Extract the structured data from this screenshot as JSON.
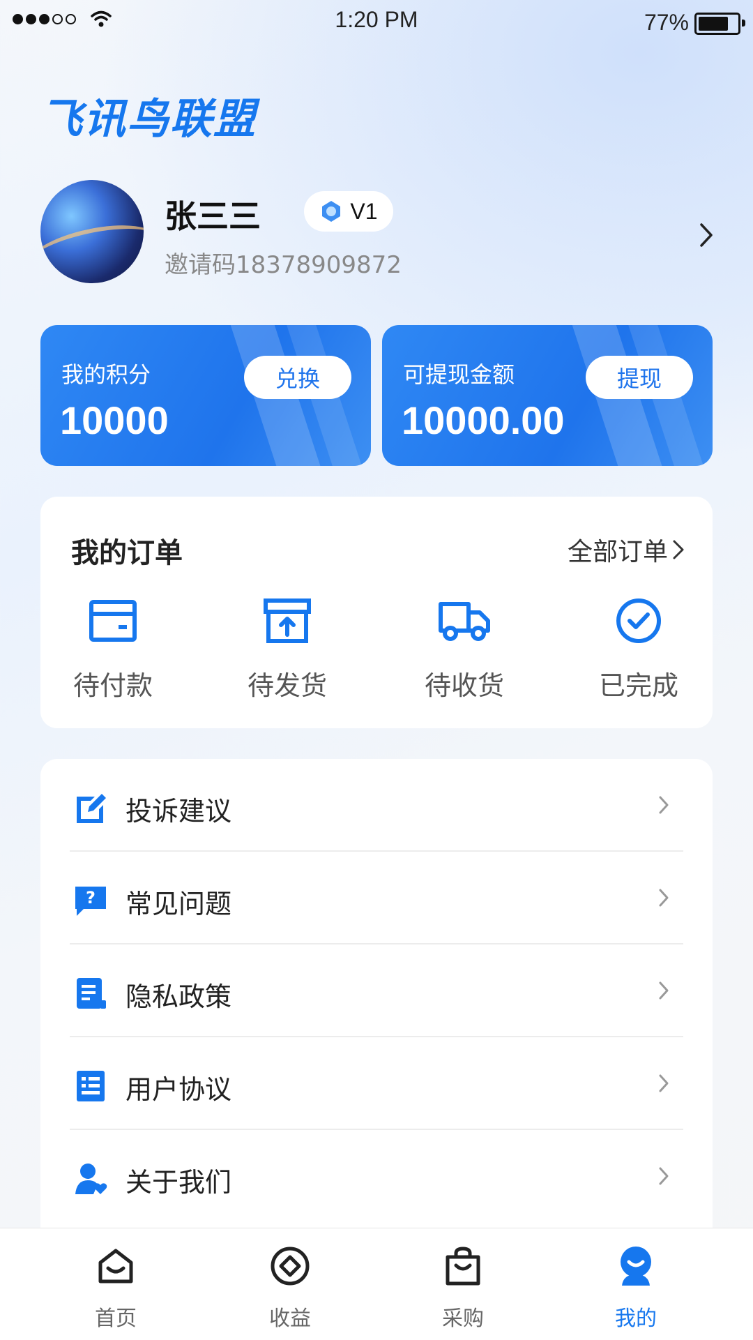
{
  "status_bar": {
    "time": "1:20 PM",
    "battery": "77%"
  },
  "app": {
    "title": "飞讯鸟联盟"
  },
  "profile": {
    "name": "张三三",
    "level": "V1",
    "invite": "邀请码18378909872"
  },
  "cards": [
    {
      "label": "我的积分",
      "value": "10000",
      "button": "兑换"
    },
    {
      "label": "可提现金额",
      "value": "10000.00",
      "button": "提现"
    }
  ],
  "orders": {
    "title": "我的订单",
    "all_label": "全部订单",
    "items": [
      {
        "label": "待付款",
        "icon": "wallet-icon"
      },
      {
        "label": "待发货",
        "icon": "box-upload-icon"
      },
      {
        "label": "待收货",
        "icon": "truck-icon"
      },
      {
        "label": "已完成",
        "icon": "check-circle-icon"
      }
    ]
  },
  "menu": [
    {
      "label": "投诉建议",
      "icon": "edit-icon"
    },
    {
      "label": "常见问题",
      "icon": "question-icon"
    },
    {
      "label": "隐私政策",
      "icon": "document-icon"
    },
    {
      "label": "用户协议",
      "icon": "list-icon"
    },
    {
      "label": "关于我们",
      "icon": "user-heart-icon"
    }
  ],
  "tabs": [
    {
      "label": "首页",
      "icon": "home-icon"
    },
    {
      "label": "收益",
      "icon": "income-icon"
    },
    {
      "label": "采购",
      "icon": "bag-icon"
    },
    {
      "label": "我的",
      "icon": "profile-icon",
      "active": true
    }
  ],
  "colors": {
    "accent": "#1677ee",
    "card": "#1f74ec"
  }
}
